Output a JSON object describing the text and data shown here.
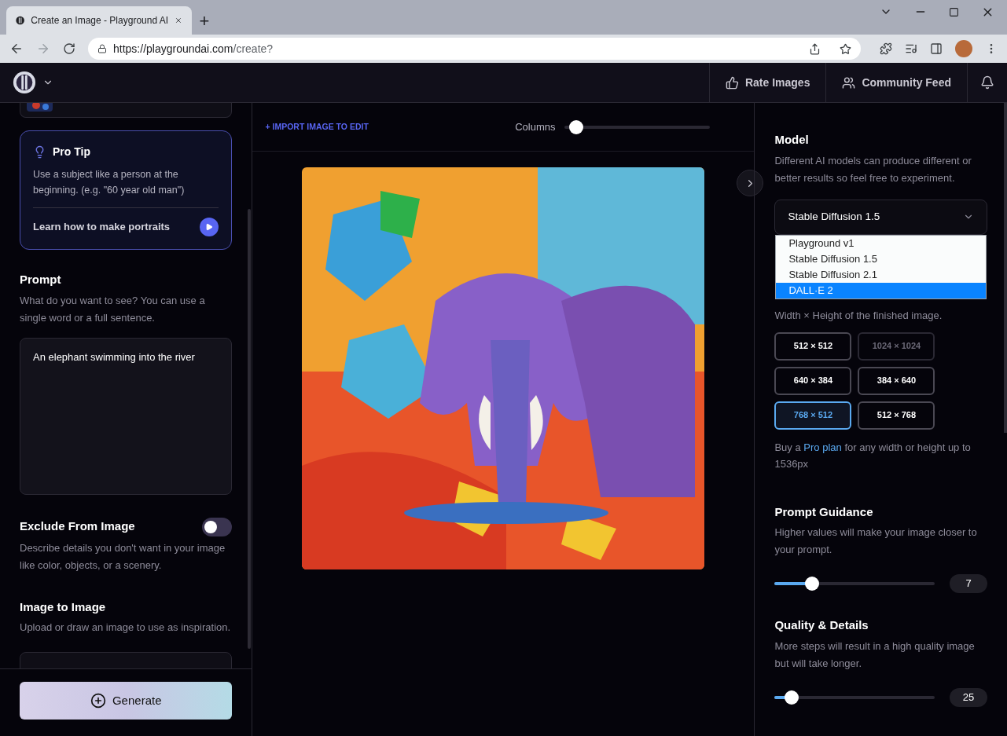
{
  "browser": {
    "tab_title": "Create an Image - Playground AI",
    "new_tab": "+",
    "url_host": "https://playgroundai.com",
    "url_path": "/create?"
  },
  "header": {
    "nav": [
      {
        "kind": "rate",
        "label": "Rate Images"
      },
      {
        "kind": "community",
        "label": "Community Feed"
      }
    ]
  },
  "sidebar": {
    "pro_tip": {
      "title": "Pro Tip",
      "text": "Use a subject like a person at the beginning. (e.g. \"60 year old man\")",
      "link": "Learn how to make portraits"
    },
    "prompt": {
      "title": "Prompt",
      "description": "What do you want to see? You can use a single word or a full sentence.",
      "value": "An elephant swimming into the river"
    },
    "exclude": {
      "title": "Exclude From Image",
      "on": false,
      "description": "Describe details you don't want in your image like color, objects, or a scenery."
    },
    "image_to_image": {
      "title": "Image to Image",
      "description": "Upload or draw an image to use as inspiration."
    },
    "generate": "Generate"
  },
  "canvas": {
    "import": "+ IMPORT IMAGE TO EDIT",
    "columns": {
      "label": "Columns",
      "level": 0.04
    }
  },
  "settings": {
    "model": {
      "title": "Model",
      "description": "Different AI models can produce different or better results so feel free to experiment.",
      "value": "Stable Diffusion 1.5",
      "options": [
        {
          "label": "Playground v1",
          "highlighted": false
        },
        {
          "label": "Stable Diffusion 1.5",
          "highlighted": false
        },
        {
          "label": "Stable Diffusion 2.1",
          "highlighted": false
        },
        {
          "label": "DALL·E 2",
          "highlighted": true
        }
      ]
    },
    "dimensions": {
      "description": "Width × Height of the finished image.",
      "sizes": [
        {
          "label": "512 × 512",
          "selected": false,
          "disabled": false
        },
        {
          "label": "1024 × 1024",
          "selected": false,
          "disabled": true
        },
        {
          "label": "640 × 384",
          "selected": false,
          "disabled": false
        },
        {
          "label": "384 × 640",
          "selected": false,
          "disabled": false
        },
        {
          "label": "768 × 512",
          "selected": true,
          "disabled": false
        },
        {
          "label": "512 × 768",
          "selected": false,
          "disabled": false
        }
      ],
      "note_link": "Pro plan",
      "note_before": "Buy a",
      "note_after": "for any width or height up to 1536px"
    },
    "sliders": [
      {
        "title": "Prompt Guidance",
        "description": "Higher values will make your image closer to your prompt.",
        "level": 0.235,
        "reading": "7"
      },
      {
        "title": "Quality & Details",
        "description": "More steps will result in a high quality image but will take longer.",
        "level": 0.108,
        "reading": "25"
      }
    ]
  }
}
